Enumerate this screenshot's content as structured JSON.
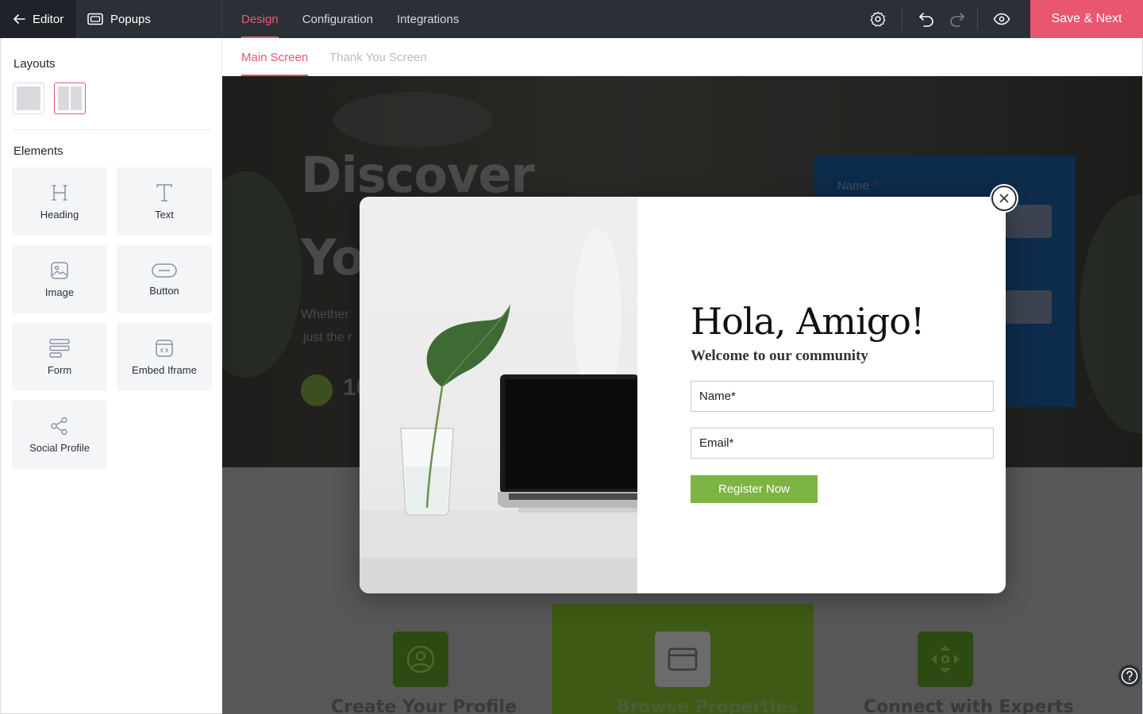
{
  "topbar": {
    "back_label": "Editor",
    "section_label": "Popups",
    "tabs": [
      {
        "label": "Design",
        "active": true
      },
      {
        "label": "Configuration",
        "active": false
      },
      {
        "label": "Integrations",
        "active": false
      }
    ],
    "icons": [
      "settings-icon",
      "undo-icon",
      "redo-icon",
      "eye-icon"
    ],
    "save_label": "Save & Next",
    "accent_color": "#e8566f"
  },
  "sidebar": {
    "layouts_title": "Layouts",
    "layouts": [
      {
        "name": "single-column",
        "selected": false
      },
      {
        "name": "two-column",
        "selected": true
      }
    ],
    "elements_title": "Elements",
    "elements": [
      {
        "label": "Heading",
        "icon": "heading-icon"
      },
      {
        "label": "Text",
        "icon": "text-icon"
      },
      {
        "label": "Image",
        "icon": "image-icon"
      },
      {
        "label": "Button",
        "icon": "button-icon"
      },
      {
        "label": "Form",
        "icon": "form-icon"
      },
      {
        "label": "Embed Iframe",
        "icon": "embed-icon"
      },
      {
        "label": "Social Profile",
        "icon": "share-icon"
      }
    ]
  },
  "subtabs": [
    {
      "label": "Main Screen",
      "active": true
    },
    {
      "label": "Thank You Screen",
      "active": false
    }
  ],
  "background_page": {
    "hero_line1": "Discover",
    "hero_line2": "Yo",
    "hero_p1": "Whether",
    "hero_p2": "just the r",
    "hero_number": "10",
    "form_label": "Name",
    "form_required": "*",
    "features": [
      "Create Your Profile",
      "Browse Properties",
      "Connect with Experts"
    ]
  },
  "popup": {
    "title": "Hola, Amigo!",
    "subtitle": "Welcome to our community",
    "name_placeholder": "Name*",
    "email_placeholder": "Email*",
    "button_label": "Register Now",
    "button_color": "#7db443"
  }
}
